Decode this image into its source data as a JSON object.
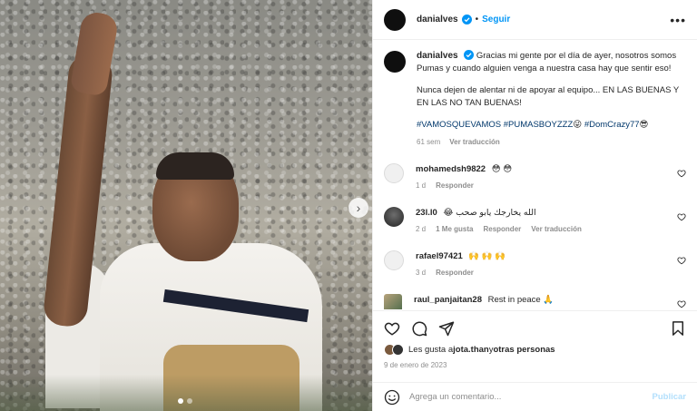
{
  "post": {
    "username": "danialves",
    "follow_label": "Seguir",
    "separator": "•",
    "more_label": "•••"
  },
  "caption": {
    "username": "danialves",
    "paragraph1": "Gracias mi gente por el día de ayer, nosotros somos Pumas y cuando alguien venga a nuestra casa hay que sentir eso!",
    "paragraph2": "Nunca dejen de alentar ni de apoyar al equipo... EN LAS BUENAS Y EN LAS NO TAN BUENAS!",
    "hashtag1": "#VAMOSQUEVAMOS",
    "hashtag2": "#PUMASBOYZZZ",
    "hashtag2_emoji": "😜",
    "hashtag3": "#DomCrazy77",
    "hashtag3_emoji": "😎",
    "time": "61 sem",
    "translate": "Ver traducción"
  },
  "comments": [
    {
      "username": "mohamedsh9822",
      "text": "😳 😳",
      "time": "1 d",
      "likes": "",
      "reply": "Responder",
      "translate": ""
    },
    {
      "username": "23l.l0",
      "text": "الله يخارجك يابو صحب 😂",
      "time": "2 d",
      "likes": "1 Me gusta",
      "reply": "Responder",
      "translate": "Ver traducción"
    },
    {
      "username": "rafael97421",
      "text": "🙌 🙌 🙌",
      "time": "3 d",
      "likes": "",
      "reply": "Responder",
      "translate": ""
    },
    {
      "username": "raul_panjaitan28",
      "text": "Rest in peace 🙏",
      "time": "",
      "likes": "",
      "reply": "",
      "translate": ""
    }
  ],
  "likes": {
    "prefix": "Les gusta a ",
    "user": "jota.than",
    "middle": " y ",
    "others": "otras personas"
  },
  "date": "9 de enero de 2023",
  "add_comment": {
    "placeholder": "Agrega un comentario...",
    "publish_label": "Publicar"
  },
  "colors": {
    "accent": "#0095f6",
    "hashtag": "#00376b",
    "muted": "#8e8e8e",
    "publish_disabled": "#b2dffc"
  },
  "carousel": {
    "slides": 2,
    "active": 1,
    "next_icon": "chevron-right-icon"
  }
}
